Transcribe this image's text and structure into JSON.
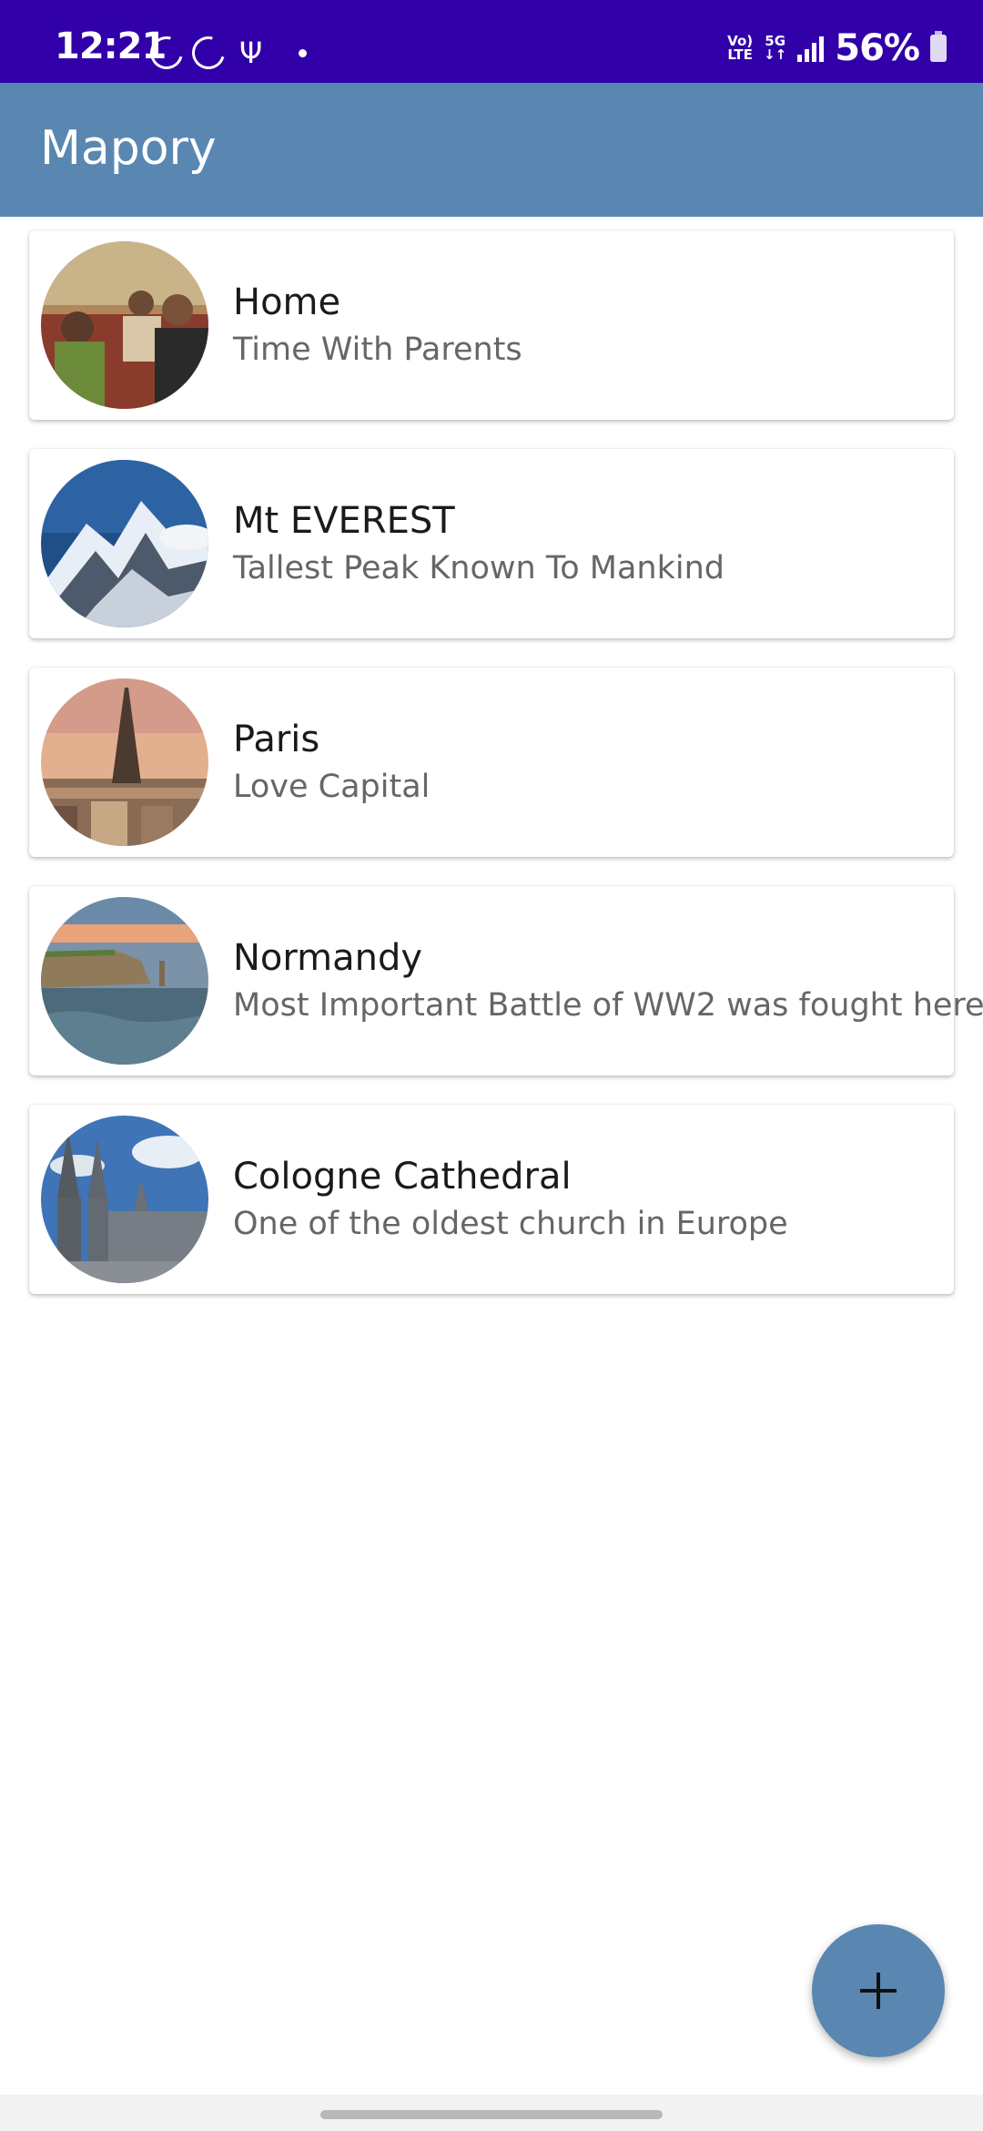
{
  "status_bar": {
    "time": "12:21",
    "network_top": "Vo)",
    "network_bottom": "LTE",
    "network_5g": "5G",
    "battery": "56%",
    "icons": [
      "sync-ring-icon",
      "sync-ring-icon",
      "usb-icon",
      "notification-dot-icon",
      "volte-icon",
      "5g-icon",
      "signal-icon",
      "battery-icon"
    ]
  },
  "app_bar": {
    "title": "Mapory"
  },
  "places": [
    {
      "title": "Home",
      "subtitle": "Time With Parents",
      "image": "family-photo"
    },
    {
      "title": "Mt EVEREST",
      "subtitle": "Tallest Peak Known To Mankind",
      "image": "mountain-photo"
    },
    {
      "title": "Paris",
      "subtitle": "Love Capital",
      "image": "eiffel-tower-photo"
    },
    {
      "title": "Normandy",
      "subtitle": "Most Important Battle of WW2 was fought here",
      "image": "cliffs-sea-photo"
    },
    {
      "title": "Cologne Cathedral",
      "subtitle": "One of the oldest church in Europe",
      "image": "cathedral-photo"
    }
  ],
  "fab": {
    "icon": "plus-icon"
  },
  "colors": {
    "status_bar": "#3200a8",
    "app_bar": "#5a87b2",
    "fab": "#5a87b2"
  }
}
